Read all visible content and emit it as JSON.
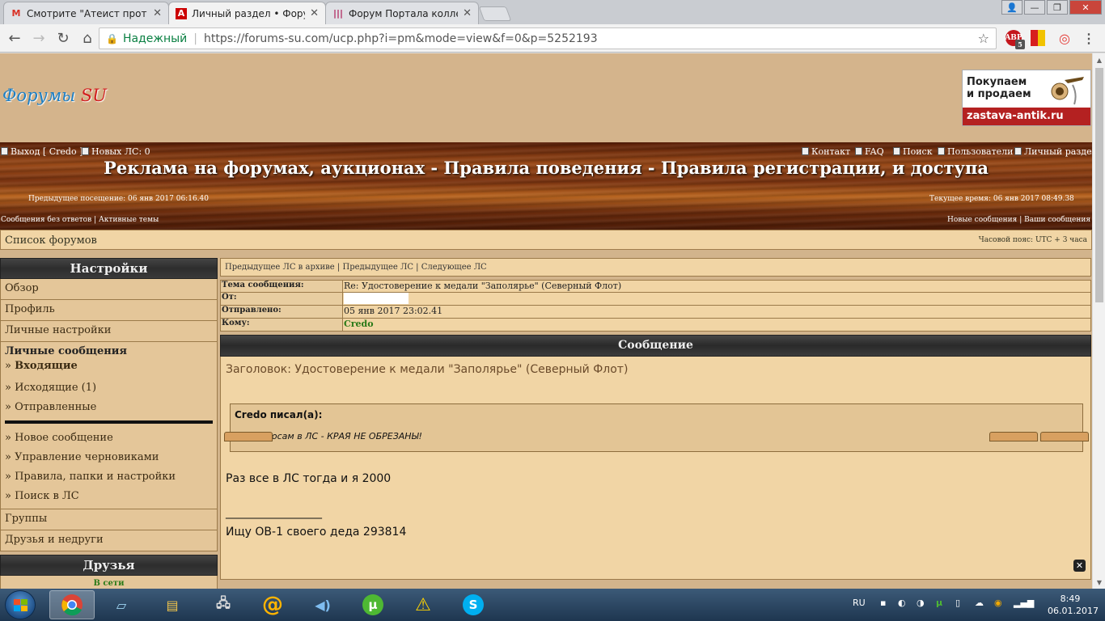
{
  "browser": {
    "tabs": [
      {
        "label": "Смотрите \"Атеист прот",
        "favicon": "gmail-icon"
      },
      {
        "label": "Личный раздел • Форум",
        "favicon": "forum-icon"
      },
      {
        "label": "Форум Портала коллекц",
        "favicon": "portal-icon"
      }
    ],
    "active_tab": 1,
    "secure_label": "Надежный",
    "url": "https://forums-su.com/ucp.php?i=pm&mode=view&f=0&p=5252193",
    "abp_badge": "5"
  },
  "header": {
    "logo_main": "Форумы ",
    "logo_su": "SU",
    "ad_line1": "Покупаем",
    "ad_line2": "и продаем",
    "ad_site": "zastava-antik.ru"
  },
  "topbar": {
    "logout": "Выход [ Credo ]",
    "new_pm": "Новых ЛС: 0",
    "contact": "Контакт",
    "faq": "FAQ",
    "search": "Поиск",
    "users": "Пользователи",
    "ucp": "Личный раздел",
    "title": "Реклама на форумах, аукционах - Правила поведения - Правила регистрации, и доступа",
    "last_visit": "Предыдущее посещение: 06 янв 2017 06:16.40",
    "current_time": "Текущее время: 06 янв 2017 08:49.38",
    "unanswered": "Сообщения без ответов",
    "active_topics": "Активные темы",
    "new_posts": "Новые сообщения",
    "your_posts": "Ваши сообщения"
  },
  "breadcrumb": {
    "forums_list": "Список форумов",
    "timezone": "Часовой пояс: UTC + 3 часа"
  },
  "sidebar": {
    "settings_title": "Настройки",
    "items": [
      "Обзор",
      "Профиль",
      "Личные настройки"
    ],
    "pm_group": {
      "title": "Личные сообщения",
      "folders": [
        "Входящие",
        "Исходящие (1)",
        "Отправленные"
      ],
      "actions": [
        "Новое сообщение",
        "Управление черновиками",
        "Правила, папки и настройки",
        "Поиск в ЛС"
      ]
    },
    "groups": "Группы",
    "friends_foes": "Друзья и недруги",
    "friends_title": "Друзья",
    "online": "В сети"
  },
  "message": {
    "nav_prev_archive": "Предыдущее ЛС в архиве",
    "nav_prev": "Предыдущее ЛС",
    "nav_next": "Следующее ЛС",
    "subject_label": "Тема сообщения:",
    "subject_value": "Re: Удостоверение к медали \"Заполярье\" (Северный Флот)",
    "from_label": "От:",
    "sent_label": "Отправлено:",
    "sent_value": "05 янв 2017 23:02.41",
    "to_label": "Кому:",
    "to_value": "Credo",
    "section_title": "Сообщение",
    "heading": "Заголовок: Удостоверение к медали \"Заполярье\" (Северный Флот)",
    "quote_author": "Credo писал(а):",
    "quote_text": "По вопросам в ЛС - КРАЯ НЕ ОБРЕЗАНЫ!",
    "body": "Раз все в ЛС тогда и я 2000",
    "sig_line": "_________________",
    "signature": "Ищу ОВ-1 своего деда 293814"
  },
  "taskbar": {
    "lang": "RU",
    "time": "8:49",
    "date": "06.01.2017"
  },
  "colors": {
    "header_bg": "#d4b48c",
    "panel_bg": "#f1d5a5",
    "accent_green": "#2a7a18",
    "logo_blue": "#1e7fc4",
    "logo_red": "#d21f1f"
  }
}
